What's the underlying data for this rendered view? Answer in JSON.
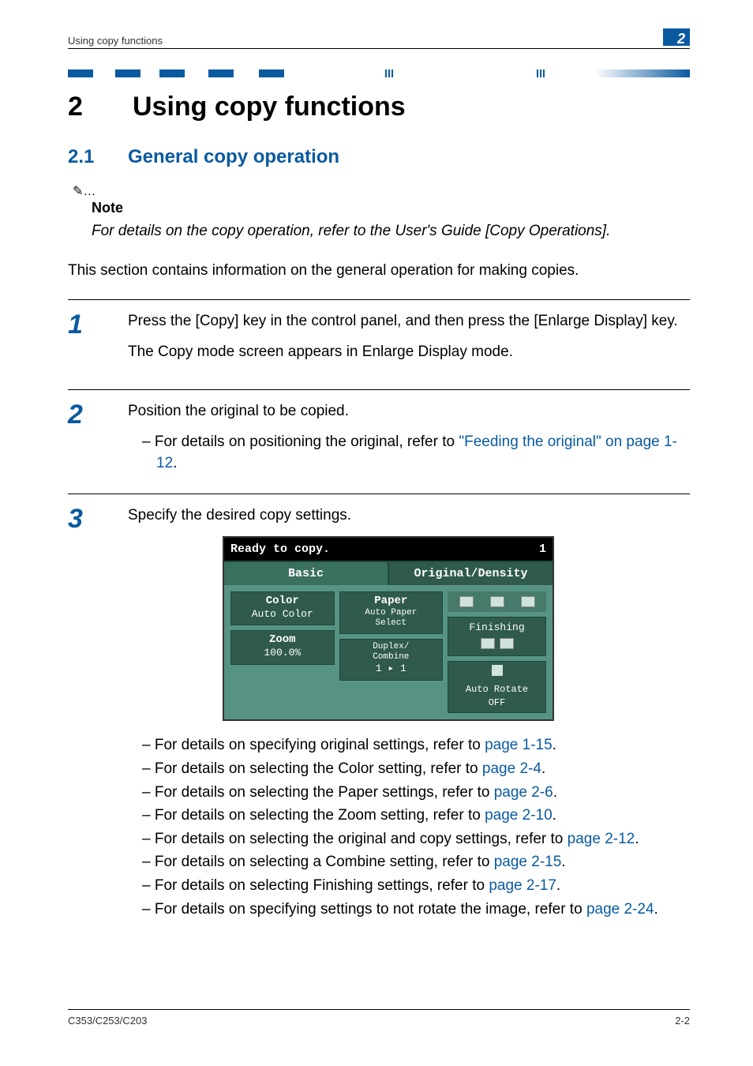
{
  "header": {
    "running": "Using copy functions",
    "chapter_badge": "2"
  },
  "chapter": {
    "number": "2",
    "title": "Using copy functions"
  },
  "section": {
    "number": "2.1",
    "title": "General copy operation"
  },
  "note": {
    "label": "Note",
    "body": "For details on the copy operation, refer to the User's Guide [Copy Operations]."
  },
  "intro": "This section contains information on the general operation for making copies.",
  "steps": [
    {
      "num": "1",
      "paras": [
        "Press the [Copy] key in the control panel, and then press the [Enlarge Display] key.",
        "The Copy mode screen appears in Enlarge Display mode."
      ]
    },
    {
      "num": "2",
      "paras": [
        "Position the original to be copied."
      ],
      "bullets": [
        {
          "pre": "For details on positioning the original, refer to ",
          "link": "\"Feeding the original\" on page 1-12",
          "post": "."
        }
      ]
    },
    {
      "num": "3",
      "paras": [
        "Specify the desired copy settings."
      ],
      "has_screenshot": true,
      "bullets": [
        {
          "pre": "For details on specifying original settings, refer to ",
          "link": "page 1-15",
          "post": "."
        },
        {
          "pre": "For details on selecting the Color setting, refer to ",
          "link": "page 2-4",
          "post": "."
        },
        {
          "pre": "For details on selecting the Paper settings, refer to ",
          "link": "page 2-6",
          "post": "."
        },
        {
          "pre": "For details on selecting the Zoom setting, refer to ",
          "link": "page 2-10",
          "post": "."
        },
        {
          "pre": "For details on selecting the original and copy settings, refer to ",
          "link": "page 2-12",
          "post": "."
        },
        {
          "pre": "For details on selecting a Combine setting, refer to ",
          "link": "page 2-15",
          "post": "."
        },
        {
          "pre": "For details on selecting Finishing settings, refer to ",
          "link": "page 2-17",
          "post": "."
        },
        {
          "pre": "For details on specifying settings to not rotate the image, refer to ",
          "link": "page 2-24",
          "post": "."
        }
      ]
    }
  ],
  "lcd": {
    "status": "Ready to copy.",
    "count": "1",
    "tabs": {
      "active": "Basic",
      "inactive": "Original/Density"
    },
    "cells": {
      "color_hdr": "Color",
      "color_val": "Auto Color",
      "paper_hdr": "Paper",
      "paper_val": "Auto Paper\nSelect",
      "zoom_hdr": "Zoom",
      "zoom_val": "100.0%",
      "duplex_hdr": "Duplex/\nCombine",
      "duplex_val": "1 ▸ 1",
      "finishing": "Finishing",
      "rotate": "Auto Rotate\nOFF"
    }
  },
  "footer": {
    "left": "C353/C253/C203",
    "right": "2-2"
  }
}
